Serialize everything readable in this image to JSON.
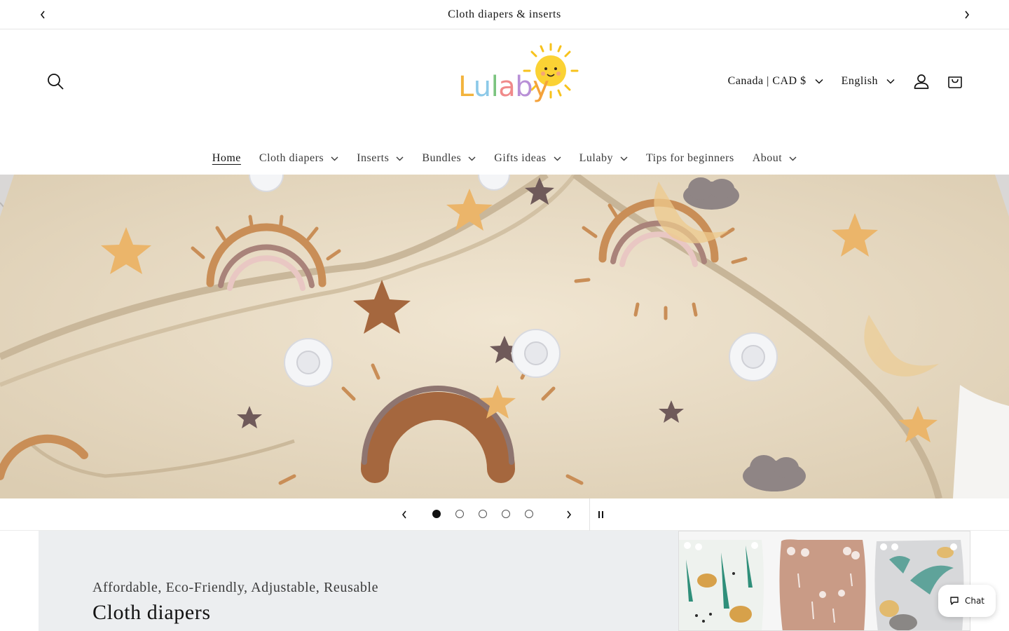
{
  "announcement": {
    "text": "Cloth diapers & inserts"
  },
  "header": {
    "logo_letters": [
      "L",
      "u",
      "l",
      "a",
      "b",
      "y"
    ],
    "logo_colors": [
      "#f2b33d",
      "#8cc9e8",
      "#7bc47f",
      "#f08a8a",
      "#b88fd6",
      "#f4a23b"
    ],
    "country_selector": "Canada | CAD $",
    "language_selector": "English"
  },
  "nav": {
    "items": [
      {
        "label": "Home",
        "active": true,
        "dropdown": false
      },
      {
        "label": "Cloth diapers",
        "active": false,
        "dropdown": true
      },
      {
        "label": "Inserts",
        "active": false,
        "dropdown": true
      },
      {
        "label": "Bundles",
        "active": false,
        "dropdown": true
      },
      {
        "label": "Gifts ideas",
        "active": false,
        "dropdown": true
      },
      {
        "label": "Lulaby",
        "active": false,
        "dropdown": true
      },
      {
        "label": "Tips for beginners",
        "active": false,
        "dropdown": false
      },
      {
        "label": "About",
        "active": false,
        "dropdown": true
      }
    ]
  },
  "slideshow": {
    "slide_count": 5,
    "current_slide": 1
  },
  "feature": {
    "subtitle": "Affordable, Eco-Friendly, Adjustable, Reusable",
    "title": "Cloth diapers"
  },
  "chat": {
    "label": "Chat"
  },
  "colors": {
    "text": "#121212",
    "feature_bg": "#eceef0",
    "hero_fabric": "#ebdfc9"
  }
}
